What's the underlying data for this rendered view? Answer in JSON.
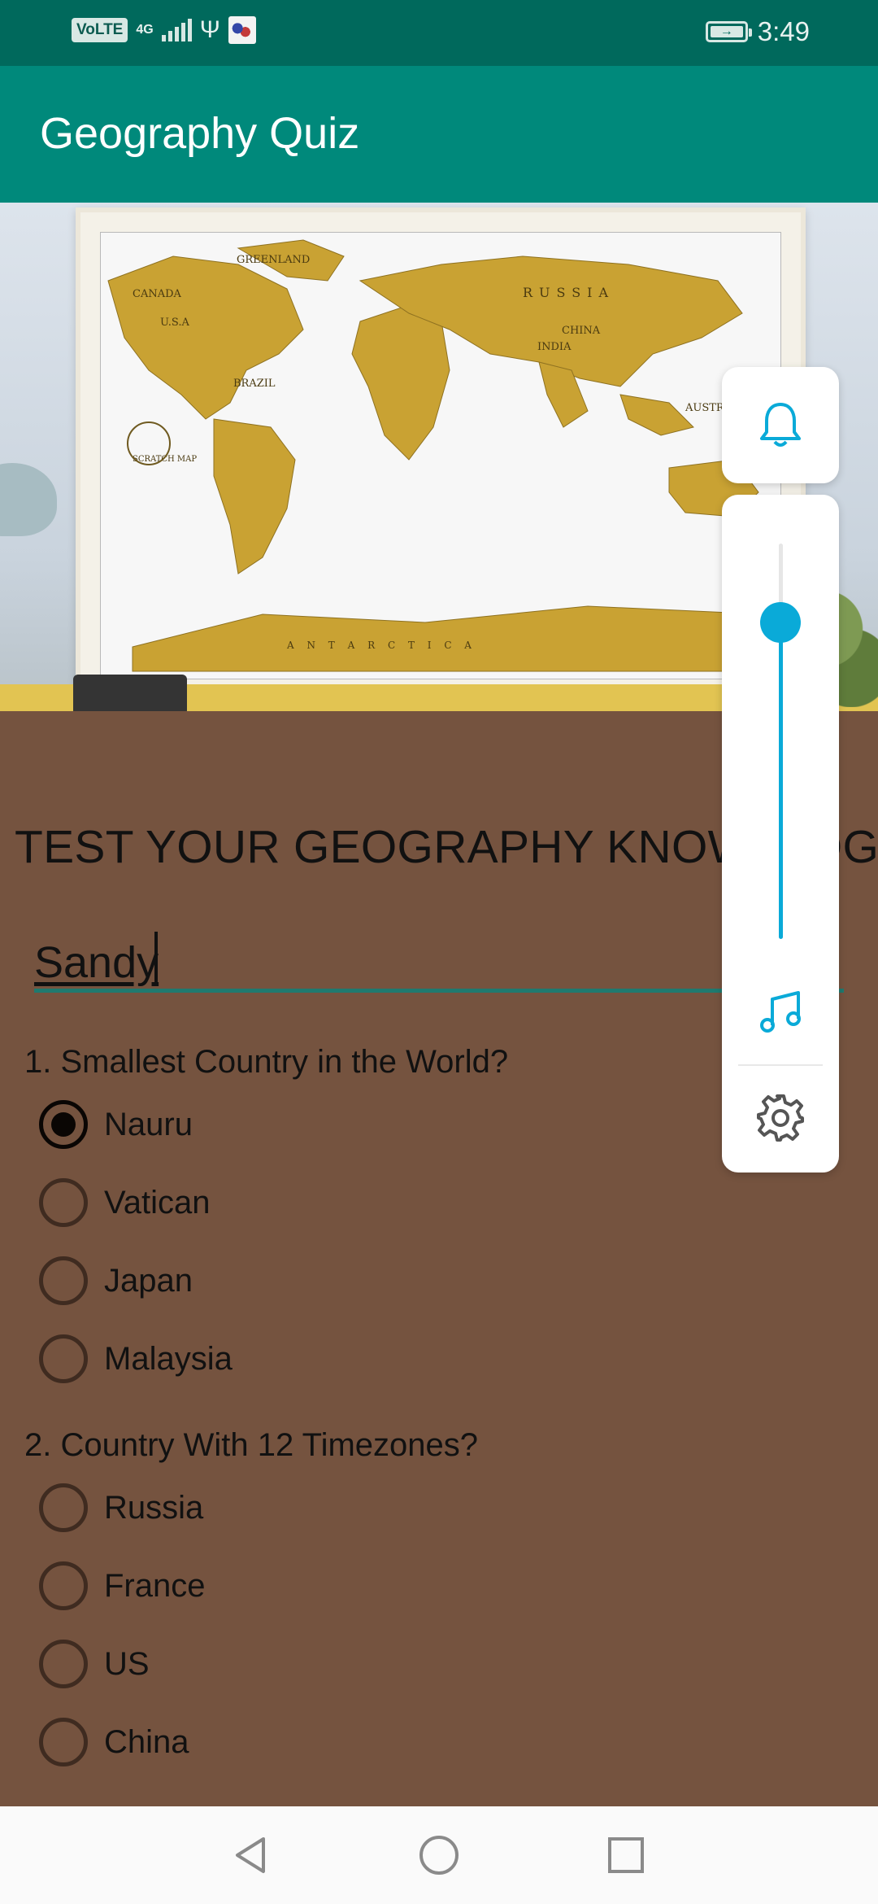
{
  "status_bar": {
    "network_badge": "VoLTE",
    "network_type": "4G",
    "time": "3:49",
    "icons": [
      "volte-icon",
      "signal-icon",
      "usb-icon",
      "app-notification-icon",
      "battery-charging-icon"
    ]
  },
  "app_bar": {
    "title": "Geography Quiz"
  },
  "hero": {
    "map_labels": [
      "GREENLAND",
      "CANADA",
      "U.S.A",
      "RUSSIA",
      "CHINA",
      "INDIA",
      "BRAZIL",
      "AUSTRALIA",
      "A N T A R C T I C A",
      "SCRATCH MAP"
    ]
  },
  "quiz": {
    "heading": "TEST YOUR GEOGRAPHY KNOWLEDGE",
    "name_value": "Sandy",
    "questions": [
      {
        "label": "1. Smallest Country in the World?",
        "options": [
          "Nauru",
          "Vatican",
          "Japan",
          "Malaysia"
        ],
        "selected": "Nauru"
      },
      {
        "label": "2. Country With 12 Timezones?",
        "options": [
          "Russia",
          "France",
          "US",
          "China"
        ],
        "selected": null
      }
    ]
  },
  "volume_panel": {
    "level": 0.8,
    "icons": [
      "bell-icon",
      "music-note-icon",
      "gear-icon"
    ],
    "accent_color": "#0aaad8"
  },
  "nav_bar": {
    "icons": [
      "back-icon",
      "home-icon",
      "recents-icon"
    ]
  },
  "colors": {
    "status_bar": "#00695c",
    "app_bar": "#00897b",
    "background": "#75533f",
    "input_underline": "#1f7a6f"
  }
}
